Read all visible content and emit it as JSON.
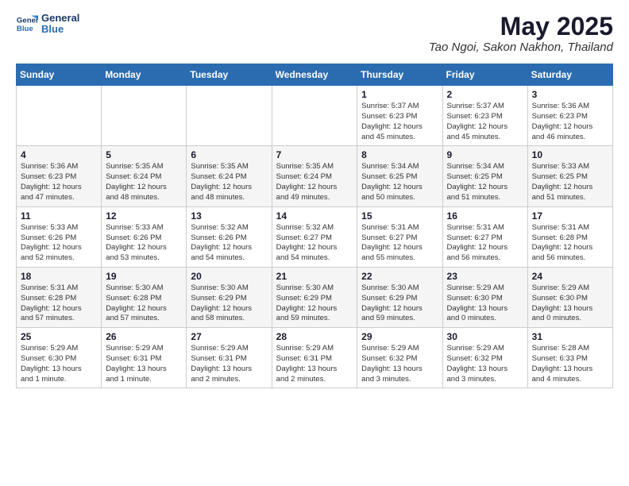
{
  "header": {
    "logo_line1": "General",
    "logo_line2": "Blue",
    "month": "May 2025",
    "location": "Tao Ngoi, Sakon Nakhon, Thailand"
  },
  "weekdays": [
    "Sunday",
    "Monday",
    "Tuesday",
    "Wednesday",
    "Thursday",
    "Friday",
    "Saturday"
  ],
  "weeks": [
    [
      {
        "day": "",
        "text": ""
      },
      {
        "day": "",
        "text": ""
      },
      {
        "day": "",
        "text": ""
      },
      {
        "day": "",
        "text": ""
      },
      {
        "day": "1",
        "text": "Sunrise: 5:37 AM\nSunset: 6:23 PM\nDaylight: 12 hours\nand 45 minutes."
      },
      {
        "day": "2",
        "text": "Sunrise: 5:37 AM\nSunset: 6:23 PM\nDaylight: 12 hours\nand 45 minutes."
      },
      {
        "day": "3",
        "text": "Sunrise: 5:36 AM\nSunset: 6:23 PM\nDaylight: 12 hours\nand 46 minutes."
      }
    ],
    [
      {
        "day": "4",
        "text": "Sunrise: 5:36 AM\nSunset: 6:23 PM\nDaylight: 12 hours\nand 47 minutes."
      },
      {
        "day": "5",
        "text": "Sunrise: 5:35 AM\nSunset: 6:24 PM\nDaylight: 12 hours\nand 48 minutes."
      },
      {
        "day": "6",
        "text": "Sunrise: 5:35 AM\nSunset: 6:24 PM\nDaylight: 12 hours\nand 48 minutes."
      },
      {
        "day": "7",
        "text": "Sunrise: 5:35 AM\nSunset: 6:24 PM\nDaylight: 12 hours\nand 49 minutes."
      },
      {
        "day": "8",
        "text": "Sunrise: 5:34 AM\nSunset: 6:25 PM\nDaylight: 12 hours\nand 50 minutes."
      },
      {
        "day": "9",
        "text": "Sunrise: 5:34 AM\nSunset: 6:25 PM\nDaylight: 12 hours\nand 51 minutes."
      },
      {
        "day": "10",
        "text": "Sunrise: 5:33 AM\nSunset: 6:25 PM\nDaylight: 12 hours\nand 51 minutes."
      }
    ],
    [
      {
        "day": "11",
        "text": "Sunrise: 5:33 AM\nSunset: 6:26 PM\nDaylight: 12 hours\nand 52 minutes."
      },
      {
        "day": "12",
        "text": "Sunrise: 5:33 AM\nSunset: 6:26 PM\nDaylight: 12 hours\nand 53 minutes."
      },
      {
        "day": "13",
        "text": "Sunrise: 5:32 AM\nSunset: 6:26 PM\nDaylight: 12 hours\nand 54 minutes."
      },
      {
        "day": "14",
        "text": "Sunrise: 5:32 AM\nSunset: 6:27 PM\nDaylight: 12 hours\nand 54 minutes."
      },
      {
        "day": "15",
        "text": "Sunrise: 5:31 AM\nSunset: 6:27 PM\nDaylight: 12 hours\nand 55 minutes."
      },
      {
        "day": "16",
        "text": "Sunrise: 5:31 AM\nSunset: 6:27 PM\nDaylight: 12 hours\nand 56 minutes."
      },
      {
        "day": "17",
        "text": "Sunrise: 5:31 AM\nSunset: 6:28 PM\nDaylight: 12 hours\nand 56 minutes."
      }
    ],
    [
      {
        "day": "18",
        "text": "Sunrise: 5:31 AM\nSunset: 6:28 PM\nDaylight: 12 hours\nand 57 minutes."
      },
      {
        "day": "19",
        "text": "Sunrise: 5:30 AM\nSunset: 6:28 PM\nDaylight: 12 hours\nand 57 minutes."
      },
      {
        "day": "20",
        "text": "Sunrise: 5:30 AM\nSunset: 6:29 PM\nDaylight: 12 hours\nand 58 minutes."
      },
      {
        "day": "21",
        "text": "Sunrise: 5:30 AM\nSunset: 6:29 PM\nDaylight: 12 hours\nand 59 minutes."
      },
      {
        "day": "22",
        "text": "Sunrise: 5:30 AM\nSunset: 6:29 PM\nDaylight: 12 hours\nand 59 minutes."
      },
      {
        "day": "23",
        "text": "Sunrise: 5:29 AM\nSunset: 6:30 PM\nDaylight: 13 hours\nand 0 minutes."
      },
      {
        "day": "24",
        "text": "Sunrise: 5:29 AM\nSunset: 6:30 PM\nDaylight: 13 hours\nand 0 minutes."
      }
    ],
    [
      {
        "day": "25",
        "text": "Sunrise: 5:29 AM\nSunset: 6:30 PM\nDaylight: 13 hours\nand 1 minute."
      },
      {
        "day": "26",
        "text": "Sunrise: 5:29 AM\nSunset: 6:31 PM\nDaylight: 13 hours\nand 1 minute."
      },
      {
        "day": "27",
        "text": "Sunrise: 5:29 AM\nSunset: 6:31 PM\nDaylight: 13 hours\nand 2 minutes."
      },
      {
        "day": "28",
        "text": "Sunrise: 5:29 AM\nSunset: 6:31 PM\nDaylight: 13 hours\nand 2 minutes."
      },
      {
        "day": "29",
        "text": "Sunrise: 5:29 AM\nSunset: 6:32 PM\nDaylight: 13 hours\nand 3 minutes."
      },
      {
        "day": "30",
        "text": "Sunrise: 5:29 AM\nSunset: 6:32 PM\nDaylight: 13 hours\nand 3 minutes."
      },
      {
        "day": "31",
        "text": "Sunrise: 5:28 AM\nSunset: 6:33 PM\nDaylight: 13 hours\nand 4 minutes."
      }
    ]
  ]
}
